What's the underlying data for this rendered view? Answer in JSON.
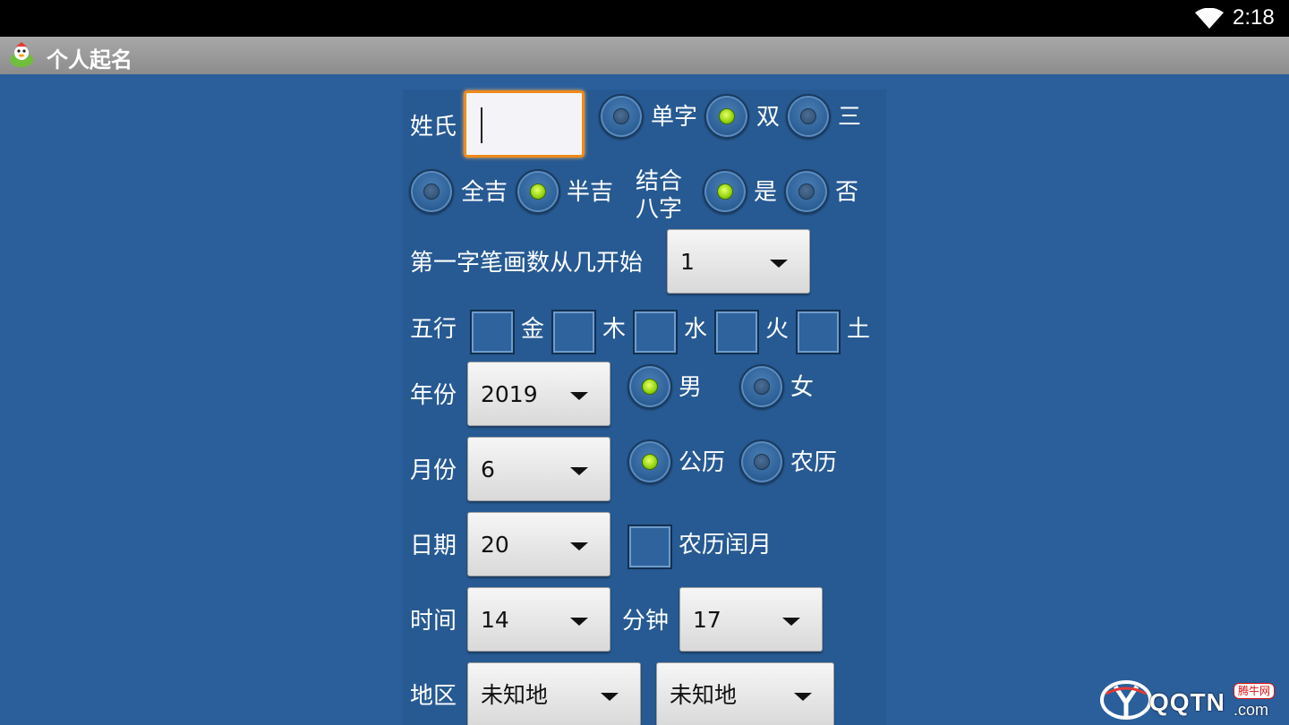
{
  "status_bar": {
    "time": "2:18"
  },
  "app": {
    "title": "个人起名"
  },
  "form": {
    "surname_label": "姓氏",
    "surname_value": "",
    "name_length_options": [
      {
        "label": "单字",
        "selected": false
      },
      {
        "label": "双",
        "selected": true
      },
      {
        "label": "三",
        "selected": false
      }
    ],
    "luck_options": [
      {
        "label": "全吉",
        "selected": false
      },
      {
        "label": "半吉",
        "selected": true
      }
    ],
    "bazi_label": "结合八字",
    "bazi_label_line1": "结合",
    "bazi_label_line2": "八字",
    "bazi_options": [
      {
        "label": "是",
        "selected": true
      },
      {
        "label": "否",
        "selected": false
      }
    ],
    "first_stroke_label": "第一字笔画数从几开始",
    "first_stroke_value": "1",
    "wuxing_label": "五行",
    "wuxing_items": [
      {
        "label": "金",
        "checked": false
      },
      {
        "label": "木",
        "checked": false
      },
      {
        "label": "水",
        "checked": false
      },
      {
        "label": "火",
        "checked": false
      },
      {
        "label": "土",
        "checked": false
      }
    ],
    "year_label": "年份",
    "year_value": "2019",
    "gender_options": [
      {
        "label": "男",
        "selected": true
      },
      {
        "label": "女",
        "selected": false
      }
    ],
    "month_label": "月份",
    "month_value": "6",
    "calendar_options": [
      {
        "label": "公历",
        "selected": true
      },
      {
        "label": "农历",
        "selected": false
      }
    ],
    "day_label": "日期",
    "day_value": "20",
    "leap_month_label": "农历闰月",
    "leap_month_checked": false,
    "hour_label": "时间",
    "hour_value": "14",
    "minute_label": "分钟",
    "minute_value": "17",
    "region_label": "地区",
    "region_province_value": "未知地",
    "region_city_value": "未知地"
  },
  "watermark": {
    "text": "QQTN",
    "suffix": ".com",
    "badge": "腾牛网"
  },
  "colors": {
    "background": "#2a5f9c",
    "title_bar": "#999999",
    "focus_border": "#ef8a1a",
    "radio_selected": "#9ad812"
  }
}
